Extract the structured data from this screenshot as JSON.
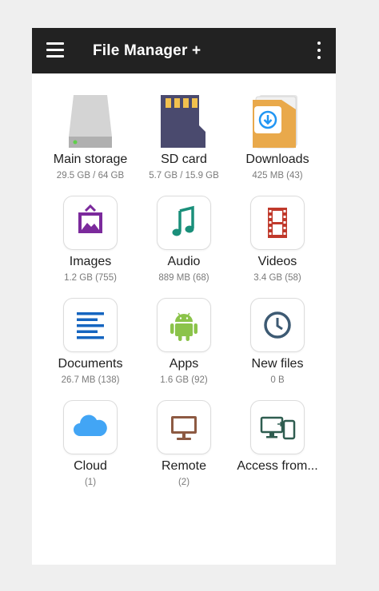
{
  "app": {
    "title": "File Manager +"
  },
  "icons": {
    "menu": "hamburger-menu-icon",
    "more": "more-vertical-icon"
  },
  "items": [
    {
      "label": "Main storage",
      "sub": "29.5 GB / 64 GB",
      "icon": "hard-drive-icon"
    },
    {
      "label": "SD card",
      "sub": "5.7 GB / 15.9 GB",
      "icon": "sd-card-icon"
    },
    {
      "label": "Downloads",
      "sub": "425 MB (43)",
      "icon": "downloads-folder-icon"
    },
    {
      "label": "Images",
      "sub": "1.2 GB (755)",
      "icon": "image-icon"
    },
    {
      "label": "Audio",
      "sub": "889 MB (68)",
      "icon": "music-note-icon"
    },
    {
      "label": "Videos",
      "sub": "3.4 GB (58)",
      "icon": "film-icon"
    },
    {
      "label": "Documents",
      "sub": "26.7 MB (138)",
      "icon": "document-lines-icon"
    },
    {
      "label": "Apps",
      "sub": "1.6 GB (92)",
      "icon": "android-icon"
    },
    {
      "label": "New files",
      "sub": "0 B",
      "icon": "clock-icon"
    },
    {
      "label": "Cloud",
      "sub": "(1)",
      "icon": "cloud-icon"
    },
    {
      "label": "Remote",
      "sub": "(2)",
      "icon": "monitor-icon"
    },
    {
      "label": "Access from...",
      "sub": "",
      "icon": "devices-icon"
    }
  ],
  "colors": {
    "appbar": "#222222",
    "images": "#7b2a9c",
    "audio": "#1a8f7a",
    "videos": "#c0392b",
    "documents": "#1565c0",
    "apps": "#8bc34a",
    "new_files": "#3d5a73",
    "cloud": "#42a5f5",
    "remote": "#8d5a42",
    "access": "#2f5d50"
  }
}
